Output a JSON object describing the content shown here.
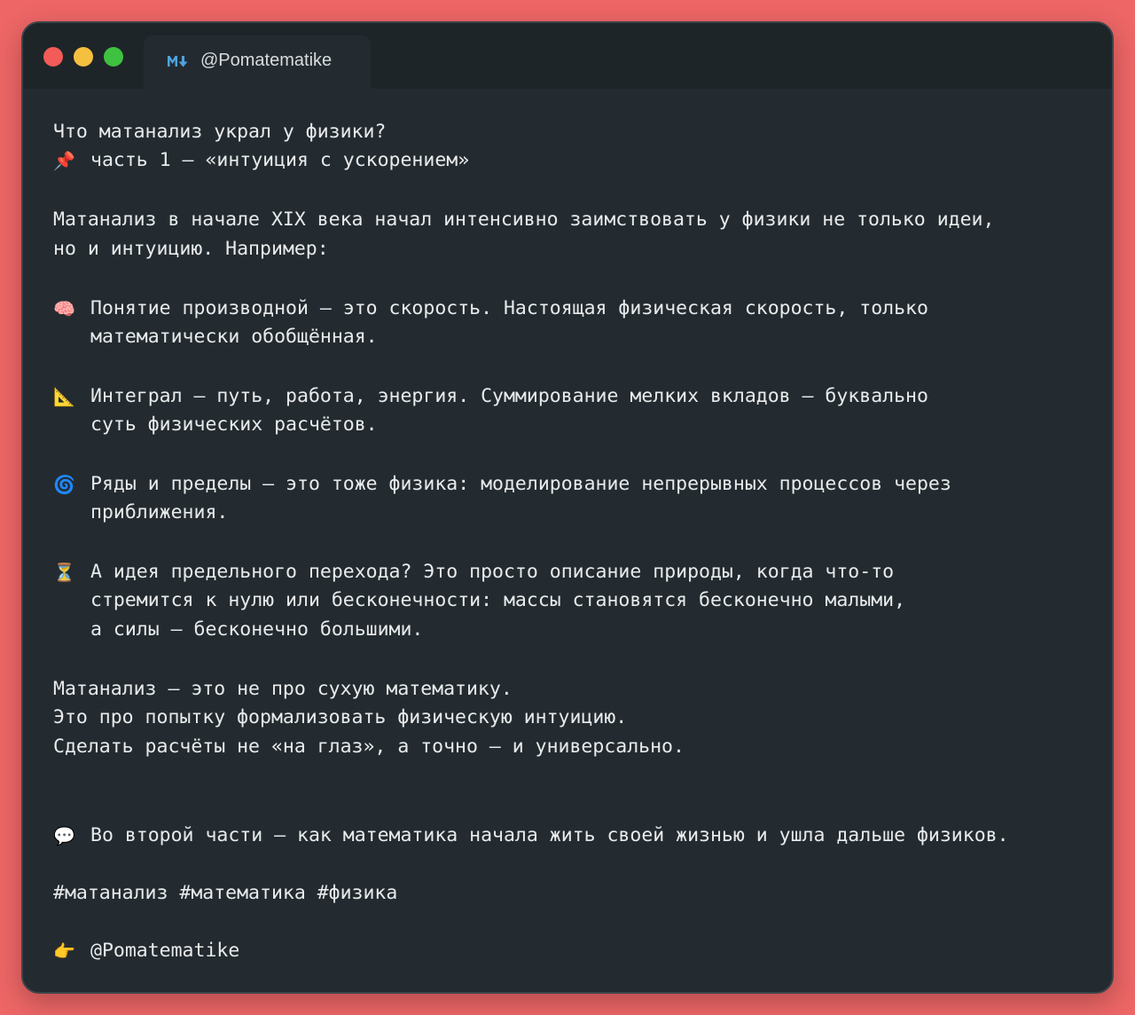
{
  "window": {
    "tab_title": "@Pomatematike",
    "tab_icon": "markdown-icon",
    "colors": {
      "background": "#ee6666",
      "window": "#232b30",
      "text": "#e8eaeb",
      "accent": "#4fa3e0"
    }
  },
  "post": {
    "title": "Что матанализ украл у физики?",
    "subtitle": "часть 1 — «интуиция с ускорением»",
    "intro_1": "Матанализ в начале XIX века начал интенсивно заимствовать у физики не только идеи,",
    "intro_2": "но и интуицию. Например:",
    "item1_line1": "Понятие производной — это скорость. Настоящая физическая скорость, только",
    "item1_line2": "математически обобщённая.",
    "item2_line1": "Интеграл — путь, работа, энергия. Суммирование мелких вкладов — буквально",
    "item2_line2": "суть физических расчётов.",
    "item3_line1": "Ряды и пределы — это тоже физика: моделирование непрерывных процессов через",
    "item3_line2": "приближения.",
    "item4_line1": "А идея предельного перехода? Это просто описание природы, когда что-то",
    "item4_line2": "стремится к нулю или бесконечности: массы становятся бесконечно малыми,",
    "item4_line3": "а силы — бесконечно большими.",
    "outro_1": "Матанализ — это не про сухую математику.",
    "outro_2": "Это про попытку формализовать физическую интуицию.",
    "outro_3": "Сделать расчёты не «на глаз», а точно — и универсально.",
    "teaser": "Во второй части — как математика начала жить своей жизнью и ушла дальше физиков.",
    "hashtags": "#матанализ #математика #физика",
    "signature": "@Pomatematike"
  },
  "icons": {
    "pin": "📌",
    "brain": "🧠",
    "ruler": "📐",
    "cyclone": "🌀",
    "hourglass": "⏳",
    "speech": "💬",
    "pointing": "👉"
  }
}
